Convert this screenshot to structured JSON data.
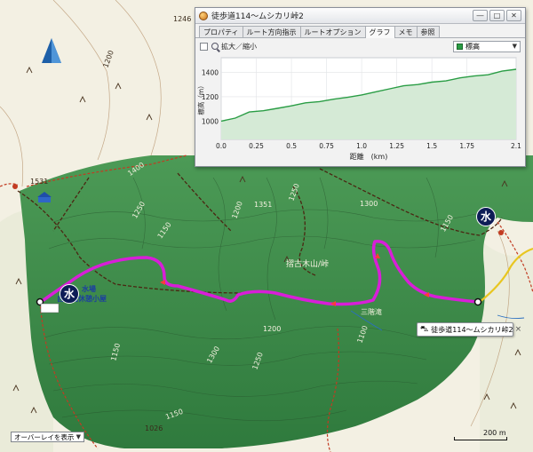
{
  "window": {
    "title": "徒歩道114〜ムシカリ峠2",
    "buttons": [
      "―",
      "□",
      "✕"
    ],
    "tabs": [
      "プロパティ",
      "ルート方向指示",
      "ルートオプション",
      "グラフ",
      "メモ",
      "参照"
    ],
    "active_tab": "グラフ",
    "zoom_label": "拡大／縮小",
    "series_select": "標高"
  },
  "chart_data": {
    "type": "area",
    "xlabel": "距離　(km)",
    "ylabel": "標高（m）",
    "x_ticks": [
      "0.0",
      "0.25",
      "0.5",
      "0.75",
      "1.0",
      "1.25",
      "1.5",
      "1.75",
      "2.1"
    ],
    "y_ticks": [
      "1000",
      "1200",
      "1400"
    ],
    "xlim": [
      0,
      2.1
    ],
    "ylim": [
      850,
      1520
    ],
    "fill_color": "#d5ead6",
    "line_color": "#2a9d45",
    "grid": true,
    "x": [
      0.0,
      0.1,
      0.2,
      0.3,
      0.4,
      0.5,
      0.6,
      0.7,
      0.8,
      0.9,
      1.0,
      1.1,
      1.2,
      1.3,
      1.4,
      1.5,
      1.6,
      1.7,
      1.8,
      1.9,
      2.0,
      2.1
    ],
    "y": [
      1000,
      1025,
      1075,
      1085,
      1105,
      1125,
      1150,
      1160,
      1180,
      1195,
      1215,
      1240,
      1265,
      1290,
      1300,
      1320,
      1330,
      1355,
      1370,
      1380,
      1410,
      1425
    ]
  },
  "map": {
    "labels": {
      "l1246": "1246",
      "l1200a": "1200",
      "l1531": "1531",
      "l1400": "1400",
      "l1250a": "1250",
      "l1150a": "1150",
      "l1200b": "1200",
      "l1250b": "1250",
      "l1351": "1351",
      "l1300": "1300",
      "l1150b": "1150",
      "l1100": "1100",
      "l1200c": "1200",
      "l1150c": "1150",
      "l1300b": "1300",
      "l1250c": "1250",
      "l1150d": "1150",
      "l1026": "1026",
      "pass": "摺古木山/峠",
      "hut": "自然園休憩小屋",
      "spring": "水場",
      "stream": "三階滝"
    },
    "water_badge": "水",
    "callout": "徒歩道114〜ムシカリ峠2",
    "overlay_select": "オーバーレイを表示",
    "scale": "200 m"
  },
  "colors": {
    "forest": "#3f8a4b",
    "route": "#d81ed8",
    "contour": "#9a6b3a",
    "trail": "#5a2a14"
  }
}
